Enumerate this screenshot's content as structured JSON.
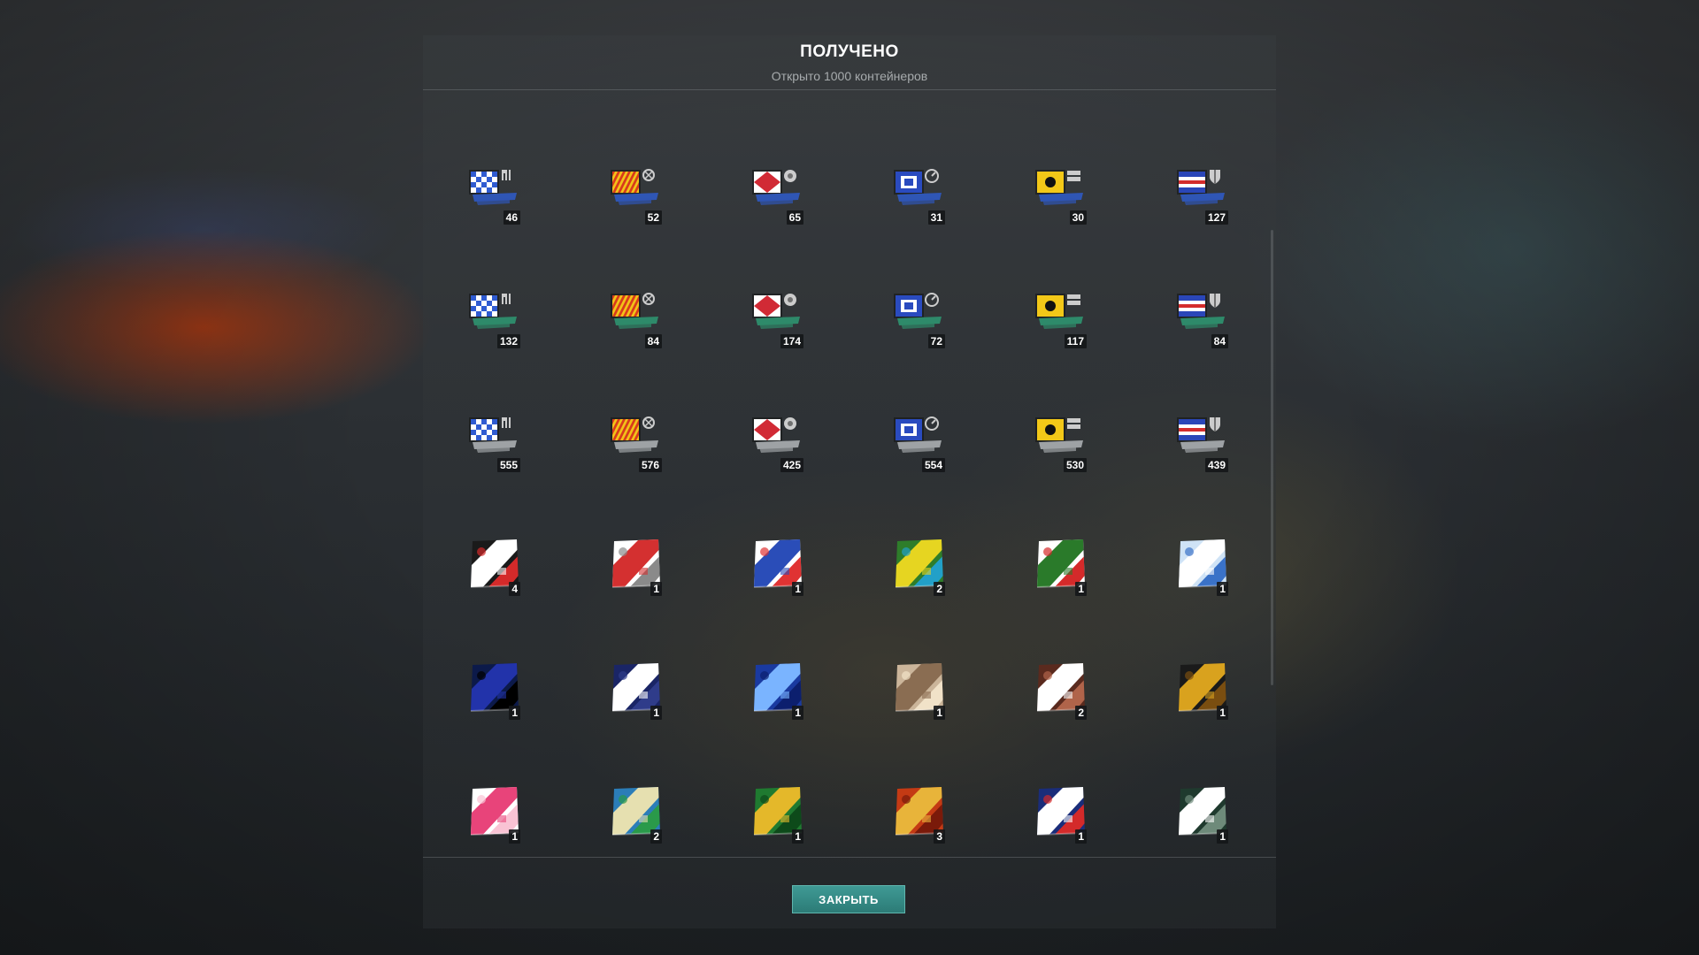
{
  "dialog": {
    "title": "ПОЛУЧЕНО",
    "subtitle": "Открыто 1000 контейнеров",
    "close_label": "ЗАКРЫТЬ"
  },
  "colors": {
    "accent_button": "#2c7b76",
    "signal_ribbon_1": "#2f56b5",
    "signal_ribbon_2": "#2e8a6a",
    "signal_ribbon_3": "#9ea2a5"
  },
  "rows": [
    {
      "items": [
        {
          "name": "signal-blue-white-checker-icon",
          "count": "46"
        },
        {
          "name": "signal-red-yellow-diagonal-icon",
          "count": "52"
        },
        {
          "name": "signal-red-diamond-icon",
          "count": "65"
        },
        {
          "name": "signal-blue-white-square-icon",
          "count": "31"
        },
        {
          "name": "signal-yellow-black-dot-icon",
          "count": "30"
        },
        {
          "name": "signal-blue-red-stripes-icon",
          "count": "127"
        }
      ]
    },
    {
      "items": [
        {
          "name": "signal-blue-white-checker-icon",
          "count": "132"
        },
        {
          "name": "signal-red-yellow-diagonal-icon",
          "count": "84"
        },
        {
          "name": "signal-red-diamond-icon",
          "count": "174"
        },
        {
          "name": "signal-blue-white-square-icon",
          "count": "72"
        },
        {
          "name": "signal-yellow-black-dot-icon",
          "count": "117"
        },
        {
          "name": "signal-blue-red-stripes-icon",
          "count": "84"
        }
      ]
    },
    {
      "items": [
        {
          "name": "signal-blue-white-checker-icon",
          "count": "555"
        },
        {
          "name": "signal-red-yellow-diagonal-icon",
          "count": "576"
        },
        {
          "name": "signal-red-diamond-icon",
          "count": "425"
        },
        {
          "name": "signal-blue-white-square-icon",
          "count": "554"
        },
        {
          "name": "signal-yellow-black-dot-icon",
          "count": "530"
        },
        {
          "name": "signal-blue-red-stripes-icon",
          "count": "439"
        }
      ]
    },
    {
      "items": [
        {
          "name": "camo-black-red-slash-icon",
          "count": "4"
        },
        {
          "name": "camo-red-grey-icon",
          "count": "1"
        },
        {
          "name": "camo-blue-white-red-icon",
          "count": "1"
        },
        {
          "name": "camo-green-yellow-triangles-icon",
          "count": "2"
        },
        {
          "name": "camo-green-white-red-icon",
          "count": "1"
        },
        {
          "name": "camo-light-blue-white-icon",
          "count": "1"
        }
      ]
    },
    {
      "items": [
        {
          "name": "camo-dark-blue-slash-icon",
          "count": "1"
        },
        {
          "name": "camo-navy-stars-icon",
          "count": "1"
        },
        {
          "name": "camo-blue-constellation-icon",
          "count": "1"
        },
        {
          "name": "camo-beige-pattern-icon",
          "count": "1"
        },
        {
          "name": "camo-brown-white-stripes-icon",
          "count": "2"
        },
        {
          "name": "camo-black-gold-icon",
          "count": "1"
        }
      ]
    },
    {
      "items": [
        {
          "name": "camo-pink-white-icon",
          "count": "1"
        },
        {
          "name": "camo-blue-green-gold-icon",
          "count": "2"
        },
        {
          "name": "camo-green-gold-icon",
          "count": "1"
        },
        {
          "name": "camo-red-gold-ornament-icon",
          "count": "3"
        },
        {
          "name": "camo-navy-red-white-icon",
          "count": "1"
        },
        {
          "name": "camo-grey-green-checker-icon",
          "count": "1"
        }
      ]
    }
  ]
}
